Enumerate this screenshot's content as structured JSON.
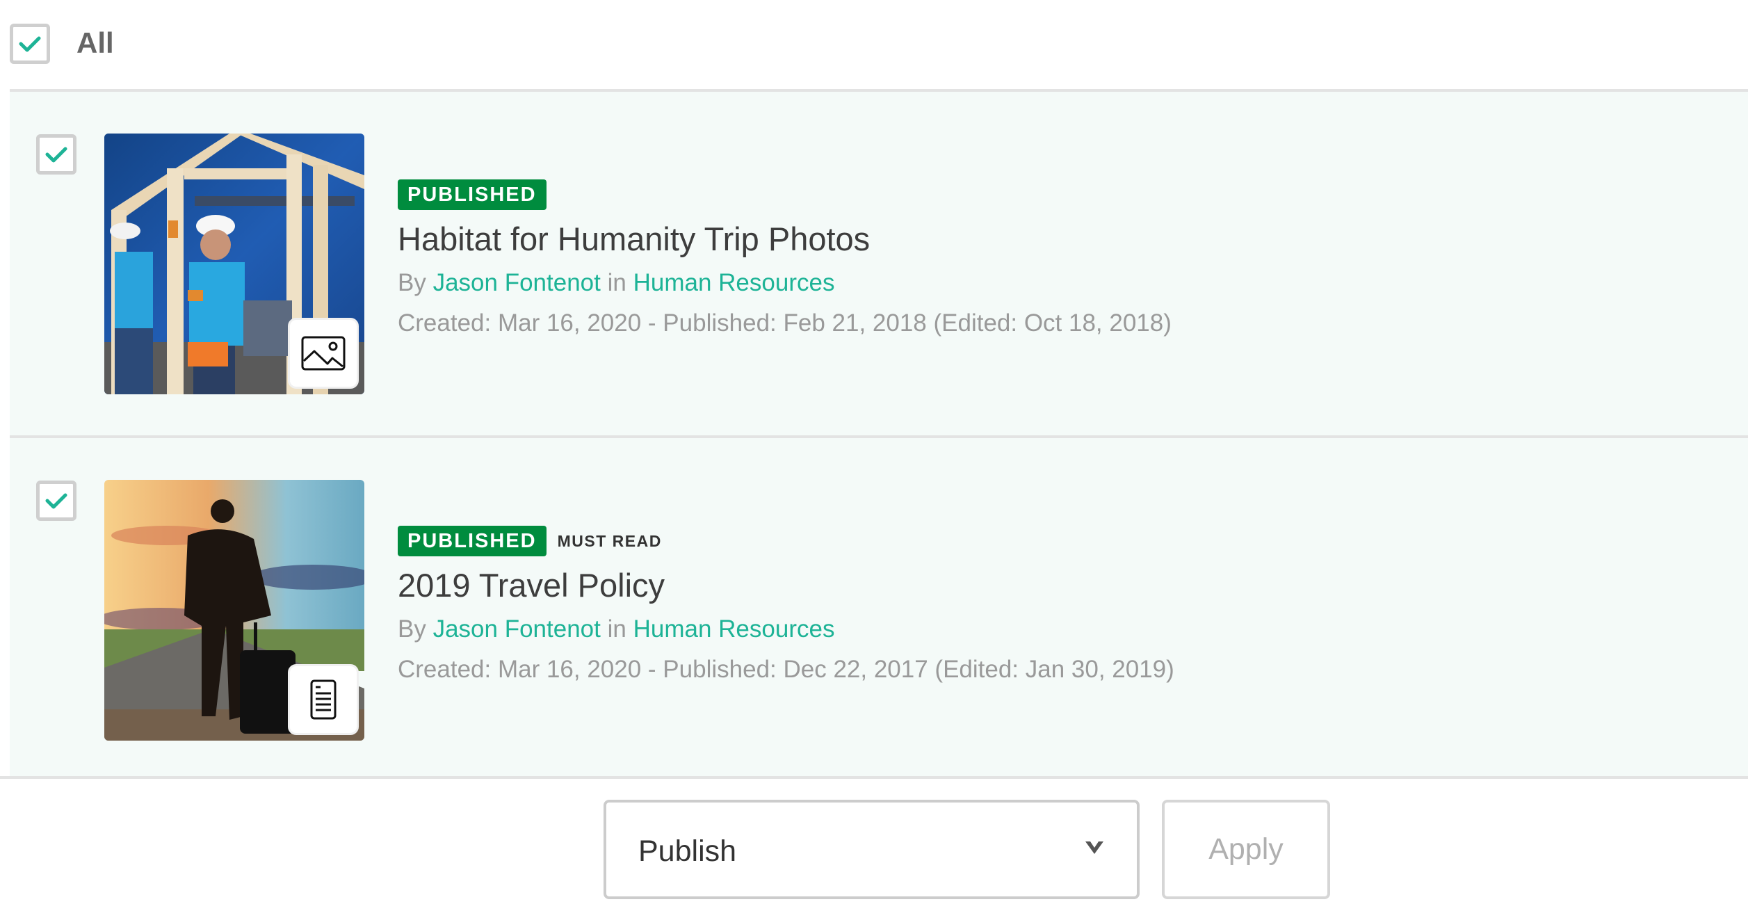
{
  "select_all": {
    "label": "All",
    "checked": true
  },
  "items": [
    {
      "checked": true,
      "status": "PUBLISHED",
      "flag": "",
      "title": "Habitat for Humanity Trip Photos",
      "by_prefix": "By",
      "author": "Jason Fontenot",
      "in_word": "in",
      "category": "Human Resources",
      "dates": "Created: Mar 16, 2020 - Published: Feb 21, 2018 (Edited: Oct 18, 2018)",
      "type_icon": "image-icon"
    },
    {
      "checked": true,
      "status": "PUBLISHED",
      "flag": "MUST READ",
      "title": "2019 Travel Policy",
      "by_prefix": "By",
      "author": "Jason Fontenot",
      "in_word": "in",
      "category": "Human Resources",
      "dates": "Created: Mar 16, 2020 - Published: Dec 22, 2017 (Edited: Jan 30, 2019)",
      "type_icon": "document-icon"
    }
  ],
  "bulk_action": {
    "selected": "Publish",
    "apply_label": "Apply"
  },
  "colors": {
    "accent": "#1db396",
    "status_published": "#008c3e",
    "row_background": "#f4faf8"
  }
}
